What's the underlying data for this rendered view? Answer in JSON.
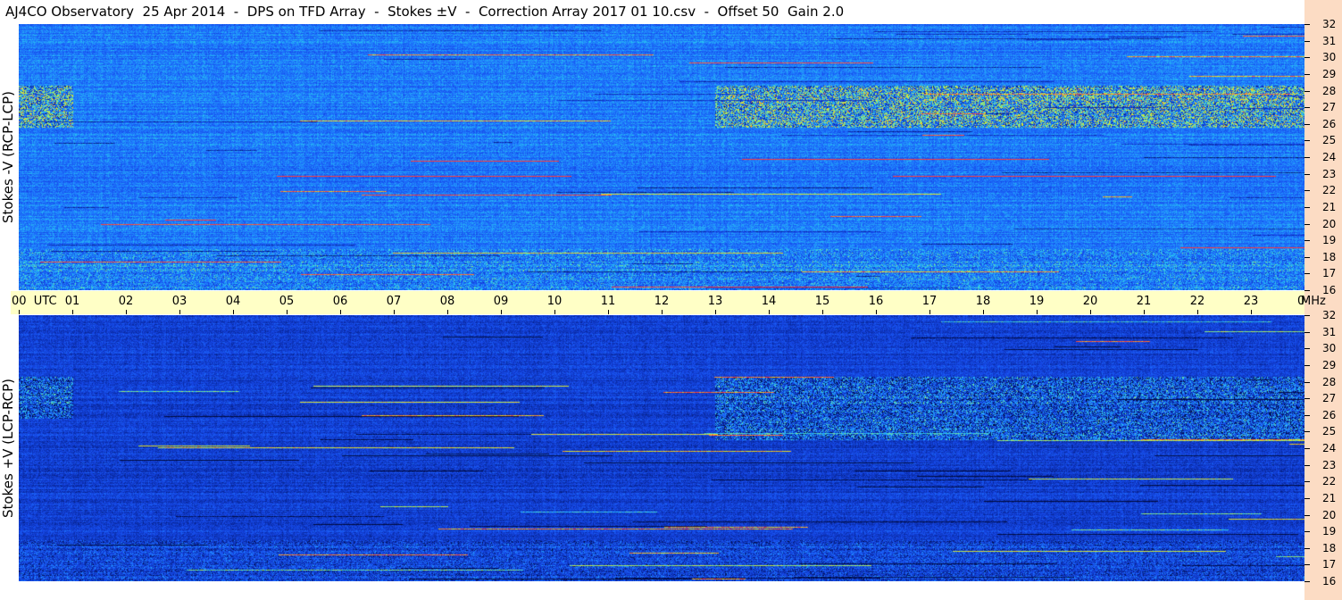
{
  "title": "AJ4CO Observatory  25 Apr 2014  -  DPS on TFD Array  -  Stokes ±V  -  Correction Array 2017 01 10.csv  -  Offset 50  Gain 2.0",
  "chart_data": [
    {
      "type": "heatmap",
      "panel": "top",
      "ylabel": "Stokes -V (RCP-LCP)",
      "y_unit": "MHz",
      "ylim": [
        16,
        32
      ],
      "y_ticks": [
        "32",
        "31",
        "30",
        "29",
        "28",
        "27",
        "26",
        "25",
        "24",
        "23",
        "22",
        "21",
        "20",
        "19",
        "18",
        "17",
        "16"
      ],
      "colormap": [
        "#000a3c",
        "#0a2ca8",
        "#1648e8",
        "#1e78ff",
        "#28c8f0",
        "#a8f060",
        "#f0e020",
        "#ff3c3c"
      ],
      "active_bands_mhz": [
        26.5,
        27.5,
        20.0,
        18.5,
        17.5
      ],
      "regions": [
        {
          "utc_start": 0.0,
          "utc_end": 1.0,
          "mhz_low": 25.8,
          "mhz_high": 28.3,
          "note": "bright"
        },
        {
          "utc_start": 13.0,
          "utc_end": 24.0,
          "mhz_low": 25.8,
          "mhz_high": 28.3,
          "note": "bright"
        }
      ]
    },
    {
      "type": "heatmap",
      "panel": "bottom",
      "ylabel": "Stokes +V (LCP-RCP)",
      "y_unit": "MHz",
      "ylim": [
        16,
        32
      ],
      "y_ticks": [
        "32",
        "31",
        "30",
        "29",
        "28",
        "27",
        "26",
        "25",
        "24",
        "23",
        "22",
        "21",
        "20",
        "19",
        "18",
        "17",
        "16"
      ],
      "colormap": [
        "#000a3c",
        "#0a2ca8",
        "#1648e8",
        "#1e78ff",
        "#28c8f0",
        "#a8f060",
        "#f0e020",
        "#ff3c3c"
      ],
      "regions": [
        {
          "utc_start": 0.0,
          "utc_end": 1.0,
          "mhz_low": 25.8,
          "mhz_high": 28.3,
          "note": "bright"
        },
        {
          "utc_start": 13.0,
          "utc_end": 24.0,
          "mhz_low": 24.5,
          "mhz_high": 28.3,
          "note": "bright"
        }
      ]
    }
  ],
  "x_axis": {
    "unit": "UTC",
    "range_hours": [
      0,
      24
    ],
    "tick_labels": [
      "00  UTC",
      "01",
      "02",
      "03",
      "04",
      "05",
      "06",
      "07",
      "08",
      "09",
      "10",
      "11",
      "12",
      "13",
      "14",
      "15",
      "16",
      "17",
      "18",
      "19",
      "20",
      "21",
      "22",
      "23",
      "00"
    ],
    "freq_unit_label": "MHz"
  }
}
